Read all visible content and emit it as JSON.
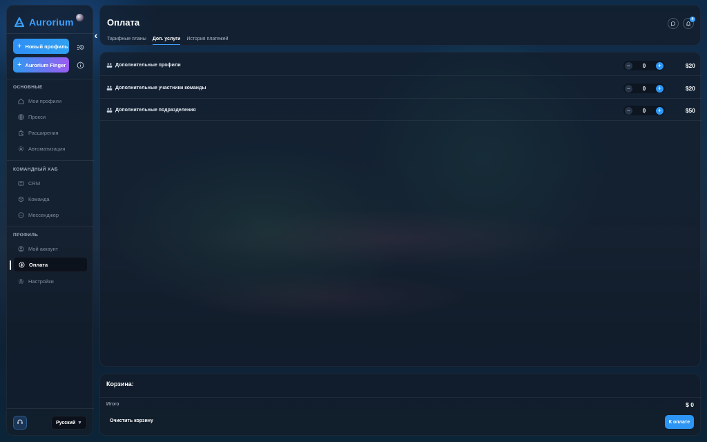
{
  "app": {
    "name": "Aurorium"
  },
  "sidebar": {
    "new_profile_label": "Новый профиль",
    "finger_label": "Aurorium Finger",
    "sections": [
      {
        "title": "ОСНОВНЫЕ",
        "items": [
          {
            "label": "Мои профили",
            "icon": "home-icon"
          },
          {
            "label": "Прокси",
            "icon": "globe-icon"
          },
          {
            "label": "Расширения",
            "icon": "puzzle-icon"
          },
          {
            "label": "Автоматизация",
            "icon": "gear-icon"
          }
        ]
      },
      {
        "title": "КОМАНДНЫЙ ХАБ",
        "items": [
          {
            "label": "CRM",
            "icon": "crm-icon"
          },
          {
            "label": "Команда",
            "icon": "team-icon"
          },
          {
            "label": "Мессенджер",
            "icon": "chat-icon"
          }
        ]
      },
      {
        "title": "ПРОФИЛЬ",
        "items": [
          {
            "label": "Мой аккаунт",
            "icon": "user-icon"
          },
          {
            "label": "Оплата",
            "icon": "wallet-icon",
            "active": true
          },
          {
            "label": "Настройки",
            "icon": "settings-icon"
          }
        ]
      }
    ],
    "language": "Русский"
  },
  "header": {
    "title": "Оплата",
    "tabs": [
      {
        "label": "Тарифные планы"
      },
      {
        "label": "Доп. услуги",
        "active": true
      },
      {
        "label": "История платежей"
      }
    ],
    "notification_count": "4"
  },
  "services": [
    {
      "name": "Дополнительные профили",
      "quantity": "0",
      "price": "$20"
    },
    {
      "name": "Дополнительные участники команды",
      "quantity": "0",
      "price": "$20"
    },
    {
      "name": "Дополнительные подразделения",
      "quantity": "0",
      "price": "$50"
    }
  ],
  "cart": {
    "title": "Корзина:",
    "total_label": "Итого",
    "total_value": "$ 0",
    "clear_label": "Очистить корзину",
    "pay_label": "К оплате"
  },
  "colors": {
    "accent": "#2d95f3",
    "brand": "#3aa0ff"
  }
}
